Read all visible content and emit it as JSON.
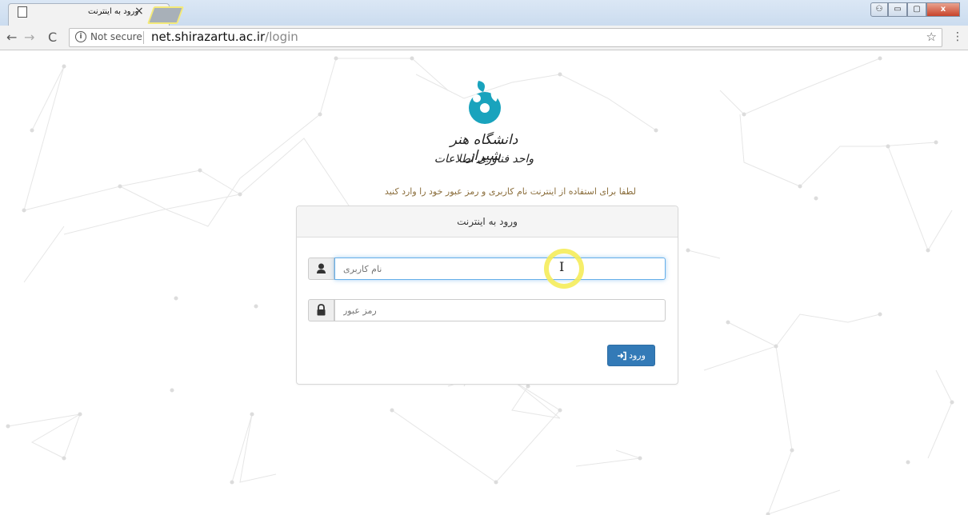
{
  "browser": {
    "tab_title": "ورود به اینترنت",
    "tab_close": "×",
    "not_secure": "Not secure",
    "url_host": "net.shirazartu.ac.ir",
    "url_path": "/login",
    "window_controls": {
      "minimize": "▭",
      "maximize": "▢",
      "close": "x"
    }
  },
  "logo": {
    "line1": "دانشگاه هنر شیراز",
    "line2": "واحد فناوری اطلاعات"
  },
  "hint": "لطفا برای استفاده از اینترنت نام کاربری و رمز عبور خود را وارد کنید",
  "panel": {
    "heading": "ورود به اینترنت",
    "username_placeholder": "نام کاربری",
    "password_placeholder": "رمز عبور",
    "login_label": "ورود"
  },
  "colors": {
    "logo_teal": "#19a3bd",
    "button": "#337ab7",
    "hint": "#8a6d3b"
  }
}
